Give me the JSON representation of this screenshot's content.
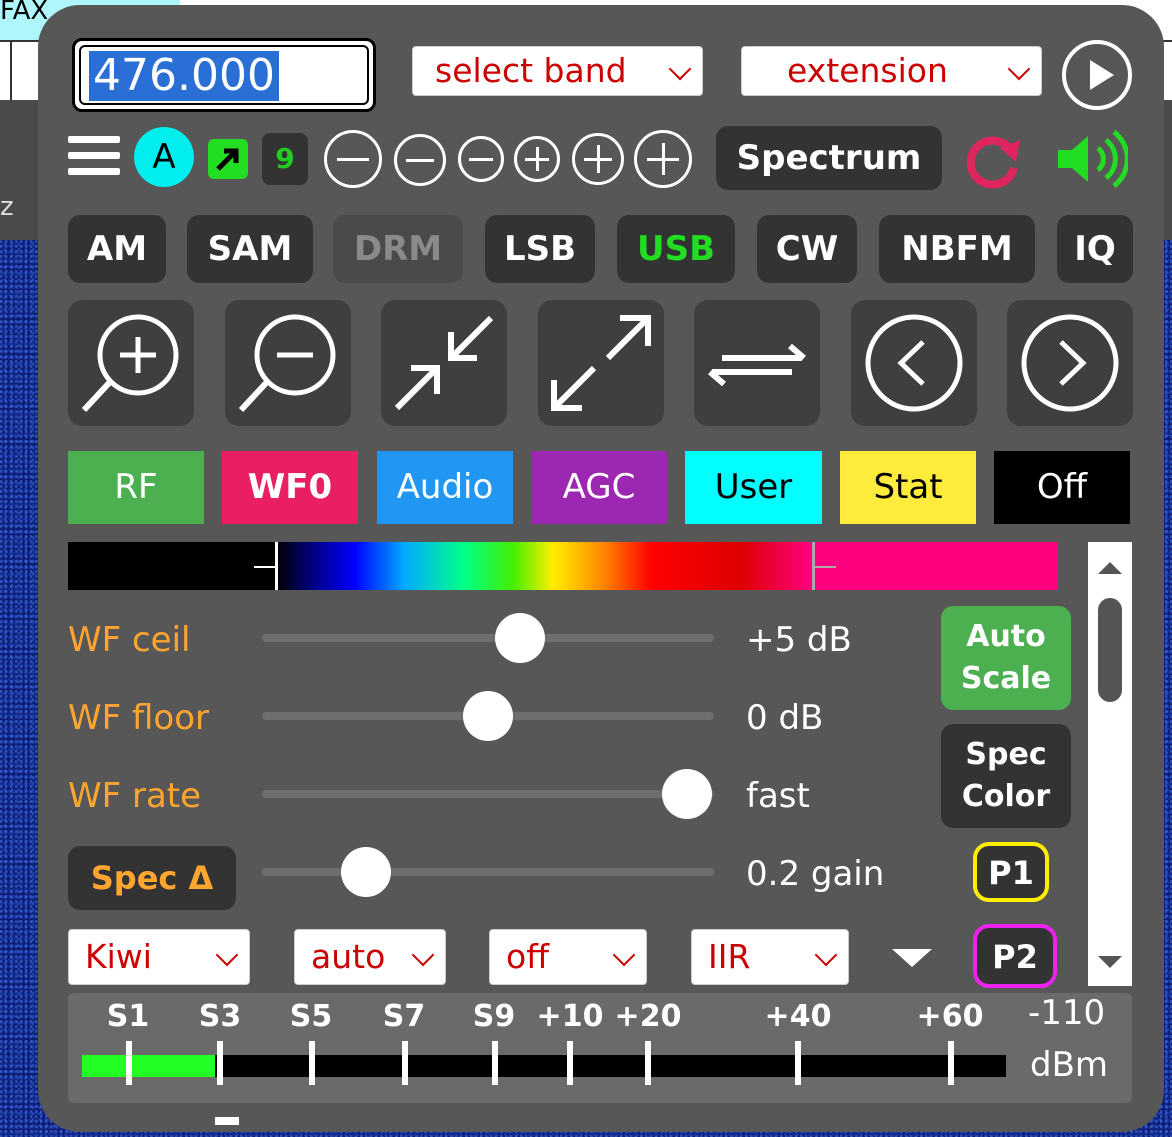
{
  "background": {
    "fax_label": "FAX",
    "mid_label": "z"
  },
  "frequency": {
    "value": "476.000"
  },
  "band_select": {
    "label": "select band"
  },
  "extension_select": {
    "label": "extension"
  },
  "toolbar": {
    "user_initial": "A",
    "badge_count": "9",
    "spectrum_label": "Spectrum",
    "icons": [
      "menu-icon",
      "external-link-icon",
      "zoom-out-icon",
      "zoom-in-icon",
      "refresh-icon",
      "speaker-icon"
    ]
  },
  "modes": [
    {
      "label": "AM",
      "state": "normal"
    },
    {
      "label": "SAM",
      "state": "normal"
    },
    {
      "label": "DRM",
      "state": "disabled"
    },
    {
      "label": "LSB",
      "state": "normal"
    },
    {
      "label": "USB",
      "state": "active"
    },
    {
      "label": "CW",
      "state": "normal"
    },
    {
      "label": "NBFM",
      "state": "normal"
    },
    {
      "label": "IQ",
      "state": "normal"
    }
  ],
  "zoom_controls": [
    "zoom-in-magnifier-icon",
    "zoom-out-magnifier-icon",
    "zoom-to-band-icon",
    "zoom-max-out-icon",
    "swap-icon",
    "pan-left-icon",
    "pan-right-icon"
  ],
  "tabs": [
    {
      "label": "RF",
      "bg": "#4caf50",
      "fg": "#ffffff"
    },
    {
      "label": "WF0",
      "bg": "#e91e63",
      "fg": "#ffffff"
    },
    {
      "label": "Audio",
      "bg": "#2196f3",
      "fg": "#ffffff"
    },
    {
      "label": "AGC",
      "bg": "#9c27b0",
      "fg": "#ffffff"
    },
    {
      "label": "User",
      "bg": "#00ffff",
      "fg": "#000000"
    },
    {
      "label": "Stat",
      "bg": "#ffeb3b",
      "fg": "#000000"
    },
    {
      "label": "Off",
      "bg": "#000000",
      "fg": "#ffffff"
    }
  ],
  "sliders": [
    {
      "label": "WF ceil",
      "value": "+5 dB",
      "level": 0.57
    },
    {
      "label": "WF floor",
      "value": "0 dB",
      "level": 0.5
    },
    {
      "label": "WF rate",
      "value": "fast",
      "level": 0.94
    },
    {
      "label": "Spec Δ",
      "value": "0.2 gain",
      "level": 0.23
    }
  ],
  "side_buttons": {
    "auto_scale": "Auto Scale",
    "spec_color": "Spec Color",
    "p1": "P1",
    "p2": "P2",
    "p1_color": "#ffee00",
    "p2_color": "#ee22ee"
  },
  "bottom_selects": [
    "Kiwi",
    "auto",
    "off",
    "IIR"
  ],
  "smeter": {
    "labels": [
      "S1",
      "S3",
      "S5",
      "S7",
      "S9",
      "+10",
      "+20",
      "+40",
      "+60"
    ],
    "level": 0.144,
    "peak": 0.17,
    "reading": "-110",
    "unit": "dBm"
  },
  "colors": {
    "panel": "#575757",
    "button": "#333333",
    "accent_orange": "#ffa630",
    "active_green": "#22dd22"
  }
}
